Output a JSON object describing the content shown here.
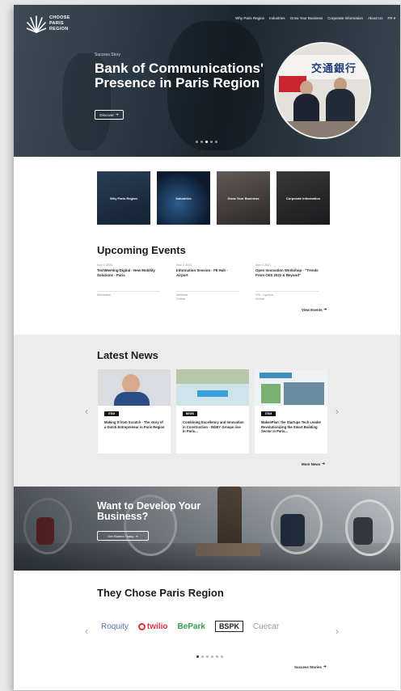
{
  "header": {
    "logo_lines": [
      "CHOOSE",
      "PARIS",
      "REGION"
    ],
    "nav": [
      "Why Paris Region",
      "Industries",
      "Grow Your Business",
      "Corporate Information",
      "About Us",
      "FR ▾"
    ]
  },
  "hero": {
    "eyebrow": "Success Story",
    "title": "Bank of Communications' Presence in Paris Region",
    "button_label": "Discover",
    "sign_text": "交通銀行",
    "active_slide": 3
  },
  "tiles": [
    {
      "label": "Why Paris Region"
    },
    {
      "label": "Industries"
    },
    {
      "label": "Grow Your Business"
    },
    {
      "label": "Corporate Information"
    }
  ],
  "events": {
    "title": "Upcoming Events",
    "items": [
      {
        "date": "Nov 2 2021",
        "title": "TechMeeting Digital - New Mobility Solutions - Paris",
        "location": "Webinaire"
      },
      {
        "date": "Nov 3 2021",
        "title": "Information Session - F8 Hub - Airport",
        "location": "Webinar\nOnline"
      },
      {
        "date": "Nov 4 2021",
        "title": "Open Innovation Workshop - \"Trends From CES 2022 & Beyond\"",
        "location": "VIV - Lyonon\nOnline"
      }
    ],
    "link_label": "View Events"
  },
  "news": {
    "title": "Latest News",
    "items": [
      {
        "badge": "ITEM",
        "title": "Making It from Scratch - The story of a Dutch Entrepreneur in Paris Region"
      },
      {
        "badge": "NEWS",
        "title": "Combining Excellency and Innovation in Construction - INSEY Groups rise in Paris..."
      },
      {
        "badge": "ITEM",
        "title": "MakesPlan: the Startups Tech Leader Revolutionizing the Smart Building Sector in Paris..."
      }
    ],
    "link_label": "More News"
  },
  "cta": {
    "title": "Want to Develop Your Business?",
    "button_label": "Get Started Today"
  },
  "clients": {
    "title": "They Chose Paris Region",
    "logos": [
      {
        "text": "Roquity",
        "color": "#4f74b8"
      },
      {
        "text": "twilio",
        "color": "#e22e3a"
      },
      {
        "text": "BePark",
        "color": "#2f9f4a"
      },
      {
        "text": "BSPK",
        "color": "#222222"
      },
      {
        "text": "Cuecar",
        "color": "#9a9a9a"
      }
    ],
    "link_label": "Success Stories",
    "active_slide": 1
  },
  "colors": {
    "hero_bg": "#2c3a45",
    "news_bg": "#ececec"
  }
}
